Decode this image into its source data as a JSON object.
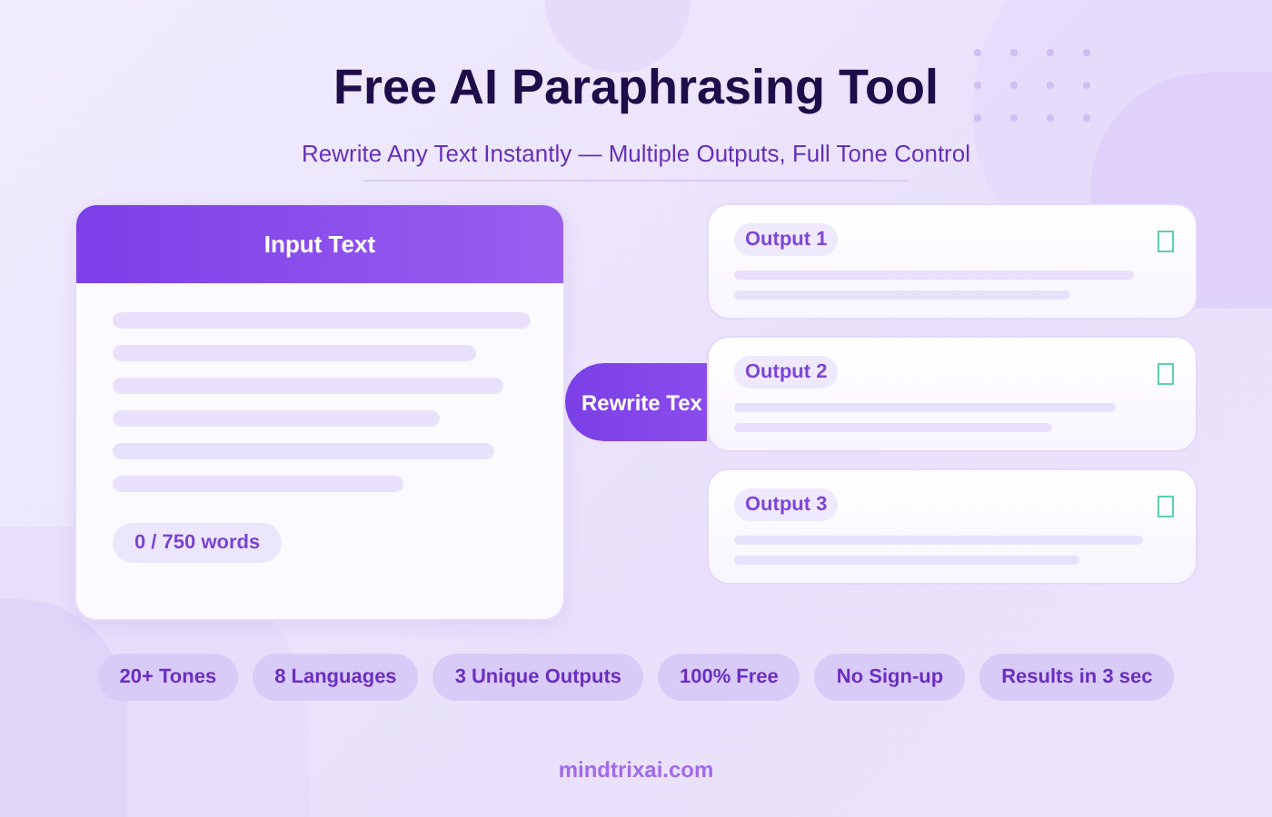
{
  "title": "Free AI Paraphrasing Tool",
  "subtitle": "Rewrite Any Text Instantly — Multiple Outputs, Full Tone Control",
  "input_card": {
    "title": "Input Text",
    "word_count": "0 / 750 words"
  },
  "rewrite_button": {
    "label": "Rewrite Tex"
  },
  "outputs": [
    {
      "label": "Output 1"
    },
    {
      "label": "Output 2"
    },
    {
      "label": "Output 3"
    }
  ],
  "features": [
    "20+ Tones",
    "8 Languages",
    "3 Unique Outputs",
    "100% Free",
    "No Sign-up",
    "Results in 3 sec"
  ],
  "footer": "mindtrixai.com"
}
